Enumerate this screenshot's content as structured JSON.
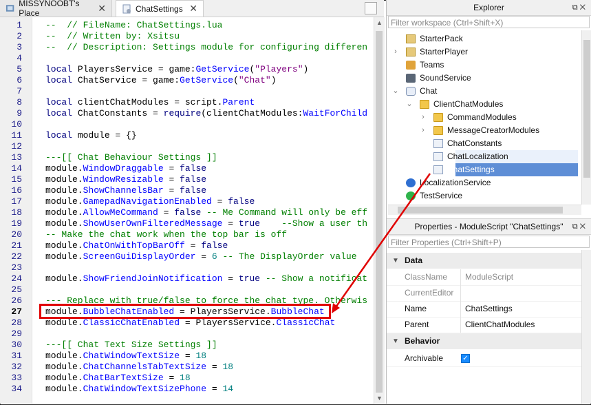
{
  "tabs": [
    {
      "label": "MISSYNOOBT's Place",
      "close": "✕"
    },
    {
      "label": "ChatSettings",
      "close": "✕"
    }
  ],
  "editor": {
    "current_line": 27,
    "line_numbers": [
      "1",
      "2",
      "3",
      "4",
      "5",
      "6",
      "7",
      "8",
      "9",
      "10",
      "11",
      "12",
      "13",
      "14",
      "15",
      "16",
      "17",
      "18",
      "19",
      "20",
      "21",
      "22",
      "23",
      "24",
      "25",
      "26",
      "27",
      "28",
      "29",
      "30",
      "31",
      "32",
      "33",
      "34"
    ],
    "lines": [
      [
        {
          "t": "--  // FileName: ChatSettings.lua",
          "c": "com"
        }
      ],
      [
        {
          "t": "--  // Written by: Xsitsu",
          "c": "com"
        }
      ],
      [
        {
          "t": "--  // Description: Settings module for configuring differen",
          "c": "com"
        }
      ],
      [],
      [
        {
          "t": "local",
          "c": "kw"
        },
        {
          "t": " PlayersService = game:",
          "c": "id"
        },
        {
          "t": "GetService",
          "c": "prop2"
        },
        {
          "t": "(",
          "c": "id"
        },
        {
          "t": "\"Players\"",
          "c": "str"
        },
        {
          "t": ")",
          "c": "id"
        }
      ],
      [
        {
          "t": "local",
          "c": "kw"
        },
        {
          "t": " ChatService = game:",
          "c": "id"
        },
        {
          "t": "GetService",
          "c": "prop2"
        },
        {
          "t": "(",
          "c": "id"
        },
        {
          "t": "\"Chat\"",
          "c": "str"
        },
        {
          "t": ")",
          "c": "id"
        }
      ],
      [],
      [
        {
          "t": "local",
          "c": "kw"
        },
        {
          "t": " clientChatModules = script.",
          "c": "id"
        },
        {
          "t": "Parent",
          "c": "prop2"
        }
      ],
      [
        {
          "t": "local",
          "c": "kw"
        },
        {
          "t": " ChatConstants = ",
          "c": "id"
        },
        {
          "t": "require",
          "c": "kw"
        },
        {
          "t": "(clientChatModules:",
          "c": "id"
        },
        {
          "t": "WaitForChild",
          "c": "prop2"
        }
      ],
      [],
      [
        {
          "t": "local",
          "c": "kw"
        },
        {
          "t": " module = {}",
          "c": "id"
        }
      ],
      [],
      [
        {
          "t": "---[[ Chat Behaviour Settings ]]",
          "c": "com"
        }
      ],
      [
        {
          "t": "module.",
          "c": "id"
        },
        {
          "t": "WindowDraggable",
          "c": "prop2"
        },
        {
          "t": " = ",
          "c": "id"
        },
        {
          "t": "false",
          "c": "kw"
        }
      ],
      [
        {
          "t": "module.",
          "c": "id"
        },
        {
          "t": "WindowResizable",
          "c": "prop2"
        },
        {
          "t": " = ",
          "c": "id"
        },
        {
          "t": "false",
          "c": "kw"
        }
      ],
      [
        {
          "t": "module.",
          "c": "id"
        },
        {
          "t": "ShowChannelsBar",
          "c": "prop2"
        },
        {
          "t": " = ",
          "c": "id"
        },
        {
          "t": "false",
          "c": "kw"
        }
      ],
      [
        {
          "t": "module.",
          "c": "id"
        },
        {
          "t": "GamepadNavigationEnabled",
          "c": "prop2"
        },
        {
          "t": " = ",
          "c": "id"
        },
        {
          "t": "false",
          "c": "kw"
        }
      ],
      [
        {
          "t": "module.",
          "c": "id"
        },
        {
          "t": "AllowMeCommand",
          "c": "prop2"
        },
        {
          "t": " = ",
          "c": "id"
        },
        {
          "t": "false",
          "c": "kw"
        },
        {
          "t": " -- Me Command will only be eff",
          "c": "com"
        }
      ],
      [
        {
          "t": "module.",
          "c": "id"
        },
        {
          "t": "ShowUserOwnFilteredMessage",
          "c": "prop2"
        },
        {
          "t": " = ",
          "c": "id"
        },
        {
          "t": "true",
          "c": "kw"
        },
        {
          "t": "    --Show a user th",
          "c": "com"
        }
      ],
      [
        {
          "t": "-- Make the chat work when the top bar is off",
          "c": "com"
        }
      ],
      [
        {
          "t": "module.",
          "c": "id"
        },
        {
          "t": "ChatOnWithTopBarOff",
          "c": "prop2"
        },
        {
          "t": " = ",
          "c": "id"
        },
        {
          "t": "false",
          "c": "kw"
        }
      ],
      [
        {
          "t": "module.",
          "c": "id"
        },
        {
          "t": "ScreenGuiDisplayOrder",
          "c": "prop2"
        },
        {
          "t": " = ",
          "c": "id"
        },
        {
          "t": "6",
          "c": "num"
        },
        {
          "t": " -- The DisplayOrder value",
          "c": "com"
        }
      ],
      [],
      [
        {
          "t": "module.",
          "c": "id"
        },
        {
          "t": "ShowFriendJoinNotification",
          "c": "prop2"
        },
        {
          "t": " = ",
          "c": "id"
        },
        {
          "t": "true",
          "c": "kw"
        },
        {
          "t": " -- Show a notificat",
          "c": "com"
        }
      ],
      [],
      [
        {
          "t": "--- Replace with true/false to force the chat type. Otherwis",
          "c": "com"
        }
      ],
      [
        {
          "t": "module.",
          "c": "id"
        },
        {
          "t": "BubbleChatEnabled",
          "c": "prop2"
        },
        {
          "t": " = PlayersService.",
          "c": "id"
        },
        {
          "t": "BubbleChat",
          "c": "prop2"
        }
      ],
      [
        {
          "t": "module.",
          "c": "id"
        },
        {
          "t": "ClassicChatEnabled",
          "c": "prop2"
        },
        {
          "t": " = PlayersService.",
          "c": "id"
        },
        {
          "t": "ClassicChat",
          "c": "prop2"
        }
      ],
      [],
      [
        {
          "t": "---[[ Chat Text Size Settings ]]",
          "c": "com"
        }
      ],
      [
        {
          "t": "module.",
          "c": "id"
        },
        {
          "t": "ChatWindowTextSize",
          "c": "prop2"
        },
        {
          "t": " = ",
          "c": "id"
        },
        {
          "t": "18",
          "c": "num"
        }
      ],
      [
        {
          "t": "module.",
          "c": "id"
        },
        {
          "t": "ChatChannelsTabTextSize",
          "c": "prop2"
        },
        {
          "t": " = ",
          "c": "id"
        },
        {
          "t": "18",
          "c": "num"
        }
      ],
      [
        {
          "t": "module.",
          "c": "id"
        },
        {
          "t": "ChatBarTextSize",
          "c": "prop2"
        },
        {
          "t": " = ",
          "c": "id"
        },
        {
          "t": "18",
          "c": "num"
        }
      ],
      [
        {
          "t": "module.",
          "c": "id"
        },
        {
          "t": "ChatWindowTextSizePhone",
          "c": "prop2"
        },
        {
          "t": " = ",
          "c": "id"
        },
        {
          "t": "14",
          "c": "num"
        }
      ]
    ]
  },
  "explorer": {
    "title": "Explorer",
    "controls": "⧉ ✕",
    "filter_placeholder": "Filter workspace (Ctrl+Shift+X)",
    "items": [
      {
        "label": "StarterPack",
        "icon": "starterpack-icon",
        "arrow": ""
      },
      {
        "label": "StarterPlayer",
        "icon": "starterplayer-icon",
        "arrow": "›"
      },
      {
        "label": "Teams",
        "icon": "teams-icon",
        "arrow": ""
      },
      {
        "label": "SoundService",
        "icon": "sound-icon",
        "arrow": ""
      },
      {
        "label": "Chat",
        "icon": "chat-icon",
        "arrow": "⌄"
      },
      {
        "label": "ClientChatModules",
        "icon": "folder-icon",
        "arrow": "⌄"
      },
      {
        "label": "CommandModules",
        "icon": "folder-icon",
        "arrow": "›"
      },
      {
        "label": "MessageCreatorModules",
        "icon": "folder-icon",
        "arrow": "›"
      },
      {
        "label": "ChatConstants",
        "icon": "modulescript-icon",
        "arrow": ""
      },
      {
        "label": "ChatLocalization",
        "icon": "modulescript-icon",
        "arrow": ""
      },
      {
        "label": "ChatSettings",
        "icon": "modulescript-icon",
        "arrow": ""
      },
      {
        "label": "LocalizationService",
        "icon": "globe-icon",
        "arrow": ""
      },
      {
        "label": "TestService",
        "icon": "check-circle-icon",
        "arrow": ""
      }
    ]
  },
  "properties": {
    "title": "Properties - ModuleScript \"ChatSettings\"",
    "controls": "⧉ ✕",
    "filter_placeholder": "Filter Properties (Ctrl+Shift+P)",
    "groups": {
      "data": "Data",
      "behavior": "Behavior"
    },
    "rows": {
      "classname_label": "ClassName",
      "classname_value": "ModuleScript",
      "currenteditor_label": "CurrentEditor",
      "currenteditor_value": "",
      "name_label": "Name",
      "name_value": "ChatSettings",
      "parent_label": "Parent",
      "parent_value": "ClientChatModules",
      "archivable_label": "Archivable",
      "archivable_checked": true
    }
  },
  "annotation": {
    "color": "#e00000"
  }
}
